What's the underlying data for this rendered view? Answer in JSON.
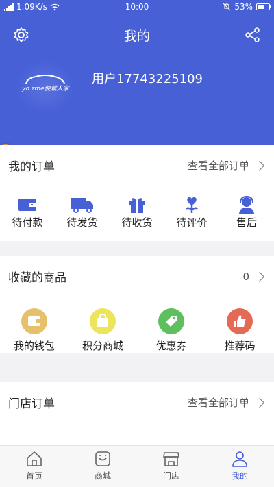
{
  "status_bar": {
    "network": "1.09K/s",
    "time": "10:00",
    "battery": "53%"
  },
  "header": {
    "title": "我的",
    "username": "用户17743225109",
    "logo_text": "yo zme便駕人家"
  },
  "orders": {
    "title": "我的订单",
    "more": "查看全部订单",
    "items": [
      {
        "label": "待付款",
        "icon": "wallet-icon"
      },
      {
        "label": "待发货",
        "icon": "truck-icon"
      },
      {
        "label": "待收货",
        "icon": "gift-icon"
      },
      {
        "label": "待评价",
        "icon": "heart-flower-icon"
      },
      {
        "label": "售后",
        "icon": "headset-agent-icon"
      }
    ]
  },
  "favorites": {
    "title": "收藏的商品",
    "count": "0"
  },
  "services": {
    "items": [
      {
        "label": "我的钱包",
        "icon": "wallet-icon",
        "color": "#e6c06a"
      },
      {
        "label": "积分商城",
        "icon": "shopping-bag-icon",
        "color": "#ece45a"
      },
      {
        "label": "优惠券",
        "icon": "tag-icon",
        "color": "#5dc05d"
      },
      {
        "label": "推荐码",
        "icon": "thumbs-up-icon",
        "color": "#e46a55"
      }
    ]
  },
  "store_orders": {
    "title": "门店订单",
    "more": "查看全部订单"
  },
  "tabbar": {
    "items": [
      {
        "label": "首页",
        "icon": "home-icon"
      },
      {
        "label": "商城",
        "icon": "shop-bag-icon"
      },
      {
        "label": "门店",
        "icon": "store-icon"
      },
      {
        "label": "我的",
        "icon": "person-icon",
        "active": true
      }
    ]
  },
  "colors": {
    "primary": "#4760d6",
    "background": "#f2f2f4"
  }
}
